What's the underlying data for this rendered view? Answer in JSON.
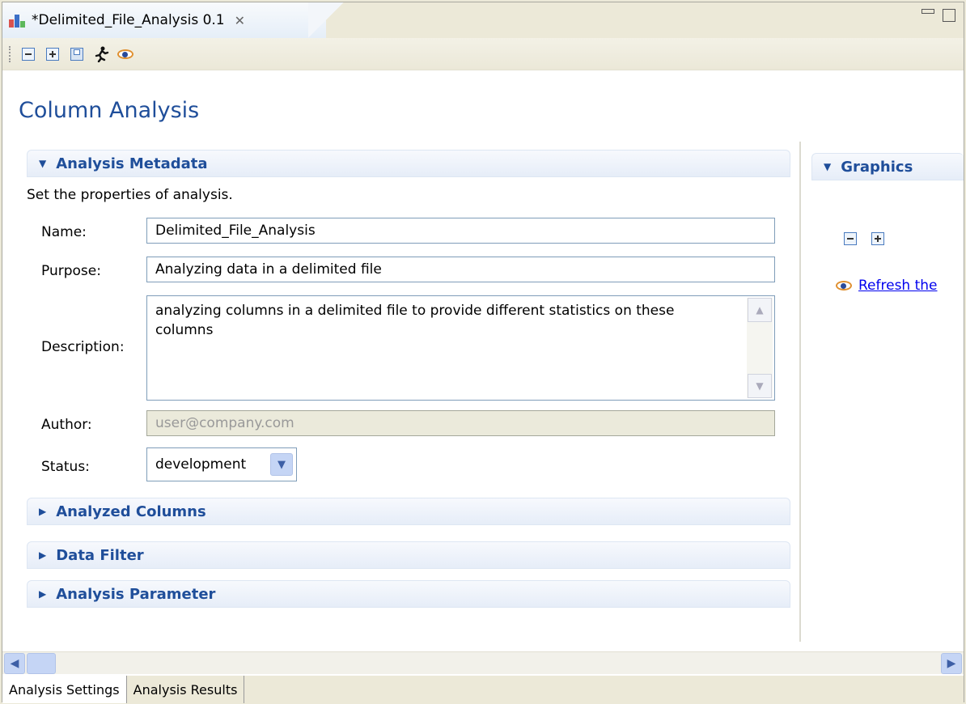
{
  "tab": {
    "title": "*Delimited_File_Analysis 0.1",
    "close_glyph": "✕"
  },
  "toolbar": {
    "icons": [
      "collapse-all-icon",
      "expand-all-icon",
      "save-icon",
      "run-icon",
      "eye-icon"
    ]
  },
  "page_title": "Column Analysis",
  "metadata": {
    "header": "Analysis Metadata",
    "description": "Set the properties of analysis.",
    "name_label": "Name:",
    "name_value": "Delimited_File_Analysis",
    "purpose_label": "Purpose:",
    "purpose_value": "Analyzing data in a delimited file",
    "description_label": "Description:",
    "description_value": "analyzing columns in a delimited file to provide different statistics on these columns",
    "author_label": "Author:",
    "author_value": "user@company.com",
    "status_label": "Status:",
    "status_value": "development"
  },
  "sections": {
    "analyzed_columns": "Analyzed Columns",
    "data_filter": "Data Filter",
    "analysis_parameter": "Analysis Parameter"
  },
  "graphics": {
    "header": "Graphics",
    "refresh_link": "Refresh the"
  },
  "bottom_tabs": [
    "Analysis Settings",
    "Analysis Results"
  ],
  "colors": {
    "title_blue": "#1f4e9a",
    "link_blue": "#0000ee"
  }
}
